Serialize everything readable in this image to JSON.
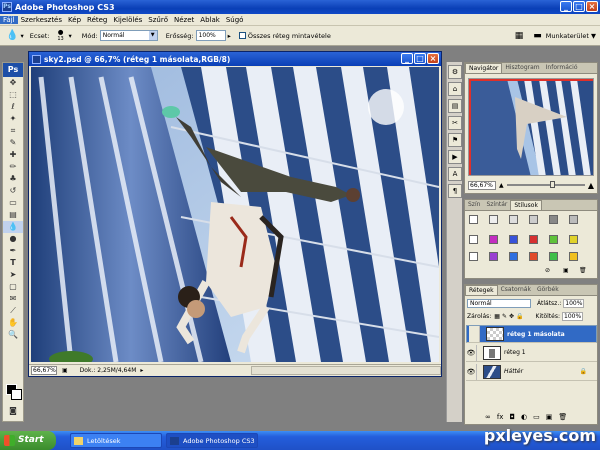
{
  "app": {
    "title": "Adobe Photoshop CS3"
  },
  "menu": [
    "Fájl",
    "Szerkesztés",
    "Kép",
    "Réteg",
    "Kijelölés",
    "Szűrő",
    "Nézet",
    "Ablak",
    "Súgó"
  ],
  "options": {
    "brush_label": "Ecset:",
    "brush_size": "13",
    "mode_label": "Mód:",
    "mode_value": "Normál",
    "strength_label": "Erősség:",
    "strength_value": "100%",
    "sample_all_label": "Összes réteg mintavétele",
    "workspace_label": "Munkaterület"
  },
  "document": {
    "title": "sky2.psd @ 66,7% (réteg 1 másolata,RGB/8)",
    "zoom": "66,67%",
    "doc_info": "Dok.: 2,25M/4,64M"
  },
  "navigator": {
    "tabs": [
      "Navigátor",
      "Hisztogram",
      "Információ"
    ],
    "zoom": "66,67%"
  },
  "swatches_panel": {
    "tabs": [
      "Szín",
      "Színtár",
      "Stílusok"
    ]
  },
  "layers_panel": {
    "tabs": [
      "Rétegek",
      "Csatornák",
      "Görbék"
    ],
    "blend_mode": "Normál",
    "opacity_label": "Átlátsz.:",
    "opacity_value": "100%",
    "lock_label": "Zárolás:",
    "fill_label": "Kitöltés:",
    "fill_value": "100%",
    "layers": [
      {
        "name": "réteg 1 másolata",
        "selected": true,
        "visible": false
      },
      {
        "name": "réteg 1",
        "selected": false,
        "visible": true
      },
      {
        "name": "Háttér",
        "selected": false,
        "visible": true,
        "locked": true
      }
    ]
  },
  "taskbar": {
    "start": "Start",
    "items": [
      "Letöltések",
      "Adobe Photoshop CS3"
    ]
  },
  "watermark": "pxleyes.com"
}
